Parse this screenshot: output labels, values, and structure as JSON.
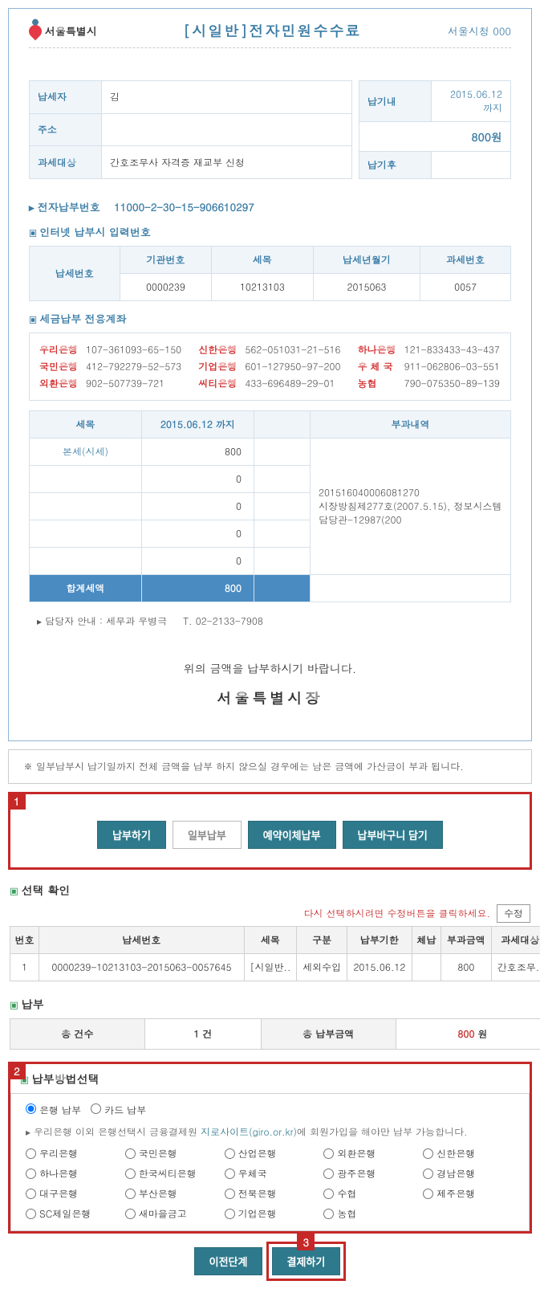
{
  "header": {
    "logo_text": "서울특별시",
    "title": "[시일반]전자민원수수료",
    "office": "서울시청 000"
  },
  "payer_info": {
    "payer_label": "납세자",
    "payer_value": "김",
    "addr_label": "주소",
    "addr_value": "",
    "subject_label": "과세대상",
    "subject_value": "간호조무사 자격증 재교부 신청",
    "due_in_label": "납기내",
    "due_in_date": "2015.06.12 까지",
    "due_in_amt": "800원",
    "due_after_label": "납기후",
    "due_after_amt": ""
  },
  "epay": {
    "label": "전자납부번호",
    "value": "11000-2-30-15-906610297"
  },
  "inet": {
    "title": "인터넷 납부시 입력번호",
    "rowlabel": "납세번호",
    "cols": [
      "기관번호",
      "세목",
      "납세년월기",
      "과세번호"
    ],
    "vals": [
      "0000239",
      "10213103",
      "2015063",
      "0057"
    ]
  },
  "banks": {
    "title": "세금납부 전용계좌",
    "list": [
      {
        "name": "우리은행",
        "acct": "107-361093-65-150"
      },
      {
        "name": "신한은행",
        "acct": "562-051031-21-516"
      },
      {
        "name": "하나은행",
        "acct": "121-833433-43-437"
      },
      {
        "name": "국민은행",
        "acct": "412-792279-52-573"
      },
      {
        "name": "기업은행",
        "acct": "601-127950-97-200"
      },
      {
        "name": "우 체 국",
        "acct": "911-062806-03-551"
      },
      {
        "name": "외환은행",
        "acct": "902-507739-721"
      },
      {
        "name": "씨티은행",
        "acct": "433-696489-29-01"
      },
      {
        "name": "농협",
        "acct": "790-075350-89-139"
      }
    ]
  },
  "tax_table": {
    "headers": [
      "세목",
      "2015.06.12 까지",
      "",
      "부과내역"
    ],
    "rows": [
      {
        "name": "본세(시세)",
        "val": "800"
      },
      {
        "name": "",
        "val": "0"
      },
      {
        "name": "",
        "val": "0"
      },
      {
        "name": "",
        "val": "0"
      },
      {
        "name": "",
        "val": "0"
      }
    ],
    "detail": "201516040006081270\n시장방침제277호(2007.5.15), 정보시스템담당관-12987(200",
    "total_label": "합계세액",
    "total_val": "800"
  },
  "contact": {
    "text": "담당자 안내 : 세무과 우병극",
    "tel": "T. 02-2133-7908"
  },
  "footer_msg": "위의 금액을 납부하시기 바랍니다.",
  "mayor": "서울특별시장",
  "notice": "※ 일부납부시 납기일까지 전체 금액을 납부 하지 않으실 경우에는 남은 금액에 가산금이 부과 됩니다.",
  "buttons": {
    "pay": "납부하기",
    "partial": "일부납부",
    "reserve": "예약이체납부",
    "cart": "납부바구니 담기"
  },
  "select": {
    "title": "선택 확인",
    "edit_msg": "다시 선택하시려면 수정버튼을 클릭하세요.",
    "edit_btn": "수정",
    "cols": [
      "번호",
      "납세번호",
      "세목",
      "구분",
      "납부기한",
      "체납",
      "부과금액",
      "과세대상"
    ],
    "row": [
      "1",
      "0000239-10213103-2015063-0057645",
      "[시일반..",
      "세외수입",
      "2015.06.12",
      "",
      "800",
      "간호조무.."
    ]
  },
  "summary": {
    "title": "납부",
    "count_label": "총 건수",
    "count_val": "1 건",
    "amt_label": "총 납부금액",
    "amt_val": "800",
    "amt_unit": " 원"
  },
  "method": {
    "title": "납부방법선택",
    "opt_bank": "은행 납부",
    "opt_card": "카드 납부",
    "help_pre": "우리은행 이외 은행선택시 금융결제원 ",
    "help_link": "지로사이트(giro.or.kr)",
    "help_post": "에 회원가입을 해야만 납부 가능합니다.",
    "banks": [
      "우리은행",
      "국민은행",
      "산업은행",
      "외환은행",
      "신한은행",
      "하나은행",
      "한국씨티은행",
      "우체국",
      "광주은행",
      "경남은행",
      "대구은행",
      "부산은행",
      "전북은행",
      "수협",
      "제주은행",
      "SC제일은행",
      "새마을금고",
      "기업은행",
      "농협"
    ]
  },
  "bottom": {
    "prev": "이전단계",
    "submit": "결제하기"
  },
  "tags": {
    "1": "1",
    "2": "2",
    "3": "3"
  }
}
